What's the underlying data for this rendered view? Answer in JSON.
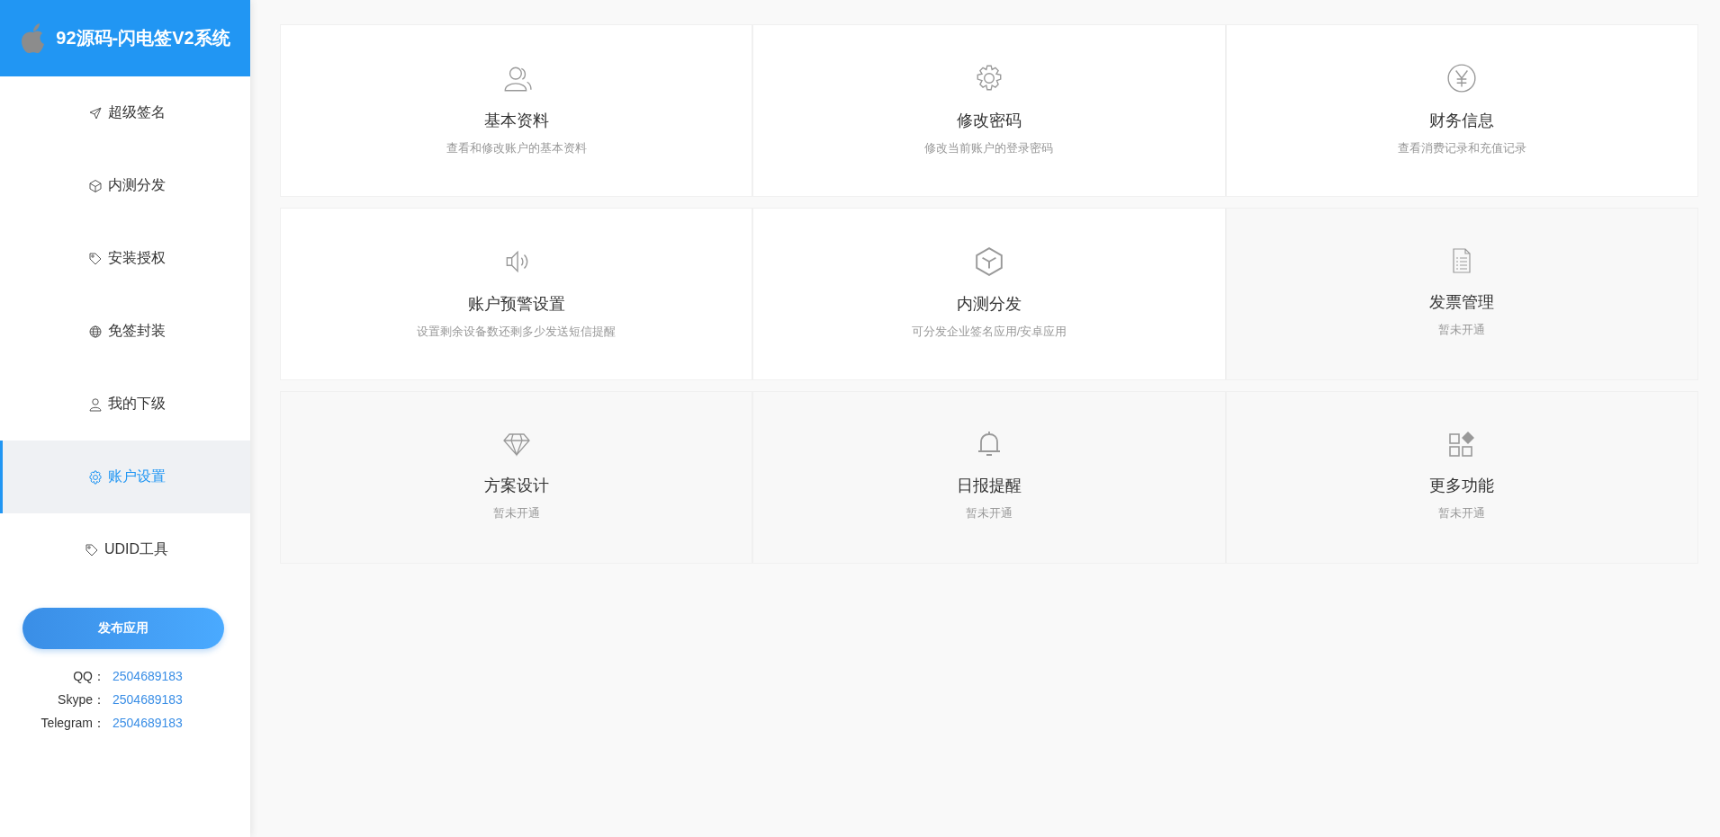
{
  "brand": {
    "title": "92源码-闪电签V2系统"
  },
  "sidebar": {
    "items": [
      {
        "label": "超级签名",
        "selected": false
      },
      {
        "label": "内测分发",
        "selected": false
      },
      {
        "label": "安装授权",
        "selected": false
      },
      {
        "label": "免签封装",
        "selected": false
      },
      {
        "label": "我的下级",
        "selected": false
      },
      {
        "label": "账户设置",
        "selected": true
      },
      {
        "label": "UDID工具",
        "selected": false
      }
    ],
    "publish_button": "发布应用",
    "contacts": [
      {
        "label": "QQ：",
        "value": "2504689183"
      },
      {
        "label": "Skype：",
        "value": "2504689183"
      },
      {
        "label": "Telegram：",
        "value": "2504689183"
      }
    ]
  },
  "cards": [
    {
      "title": "基本资料",
      "description": "查看和修改账户的基本资料",
      "disabled": false
    },
    {
      "title": "修改密码",
      "description": "修改当前账户的登录密码",
      "disabled": false
    },
    {
      "title": "财务信息",
      "description": "查看消费记录和充值记录",
      "disabled": false
    },
    {
      "title": "账户预警设置",
      "description": "设置剩余设备数还剩多少发送短信提醒",
      "disabled": false
    },
    {
      "title": "内测分发",
      "description": "可分发企业签名应用/安卓应用",
      "disabled": false
    },
    {
      "title": "发票管理",
      "description": "暂未开通",
      "disabled": true
    },
    {
      "title": "方案设计",
      "description": "暂未开通",
      "disabled": true
    },
    {
      "title": "日报提醒",
      "description": "暂未开通",
      "disabled": true
    },
    {
      "title": "更多功能",
      "description": "暂未开通",
      "disabled": true
    }
  ]
}
